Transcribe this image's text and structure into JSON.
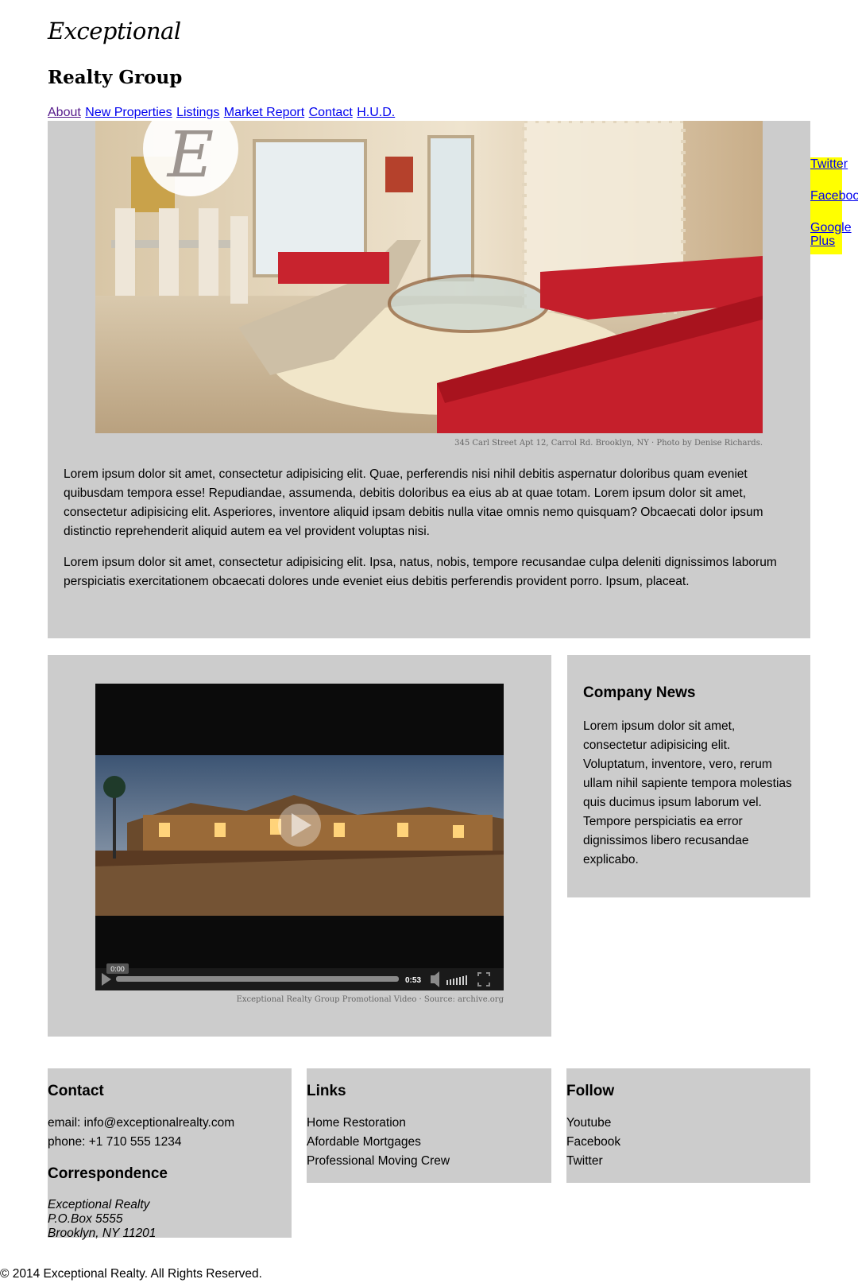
{
  "brand": {
    "script": "Exceptional",
    "name": "Realty Group"
  },
  "nav": [
    {
      "label": "About",
      "visited": true
    },
    {
      "label": "New Properties"
    },
    {
      "label": "Listings"
    },
    {
      "label": "Market Report"
    },
    {
      "label": "Contact"
    },
    {
      "label": "H.U.D."
    }
  ],
  "social": [
    "Twitter",
    "Facebook",
    "Google Plus"
  ],
  "hero": {
    "caption": "345 Carl Street Apt 12, Carrol Rd. Brooklyn, NY · Photo by Denise Richards.",
    "paragraphs": [
      "Lorem ipsum dolor sit amet, consectetur adipisicing elit. Quae, perferendis nisi nihil debitis aspernatur doloribus quam eveniet quibusdam tempora esse! Repudiandae, assumenda, debitis doloribus ea eius ab at quae totam. Lorem ipsum dolor sit amet, consectetur adipisicing elit. Asperiores, inventore aliquid ipsam debitis nulla vitae omnis nemo quisquam? Obcaecati dolor ipsum distinctio reprehenderit aliquid autem ea vel provident voluptas nisi.",
      "Lorem ipsum dolor sit amet, consectetur adipisicing elit. Ipsa, natus, nobis, tempore recusandae culpa deleniti dignissimos laborum perspiciatis exercitationem obcaecati dolores unde eveniet eius debitis perferendis provident porro. Ipsum, placeat."
    ]
  },
  "video": {
    "current_time": "0:00",
    "duration": "0:53",
    "progress": 0,
    "caption": "Exceptional Realty Group Promotional Video · Source: archive.org"
  },
  "news": {
    "title": "Company News",
    "body": "Lorem ipsum dolor sit amet, consectetur adipisicing elit. Voluptatum, inventore, vero, rerum ullam nihil sapiente tempora molestias quis ducimus ipsum laborum vel. Tempore perspiciatis ea error dignissimos libero recusandae explicabo."
  },
  "footer": {
    "contact": {
      "title": "Contact",
      "email": "email: info@exceptionalrealty.com",
      "phone": "phone: +1 710 555 1234",
      "correspondence_title": "Correspondence",
      "address": [
        "Exceptional Realty",
        "P.O.Box 5555",
        "Brooklyn, NY 11201"
      ]
    },
    "links": {
      "title": "Links",
      "items": [
        "Home Restoration",
        "Afordable Mortgages",
        "Professional Moving Crew"
      ]
    },
    "follow": {
      "title": "Follow",
      "items": [
        "Youtube",
        "Facebook",
        "Twitter"
      ]
    }
  },
  "copyright": "© 2014 Exceptional Realty. All Rights Reserved."
}
